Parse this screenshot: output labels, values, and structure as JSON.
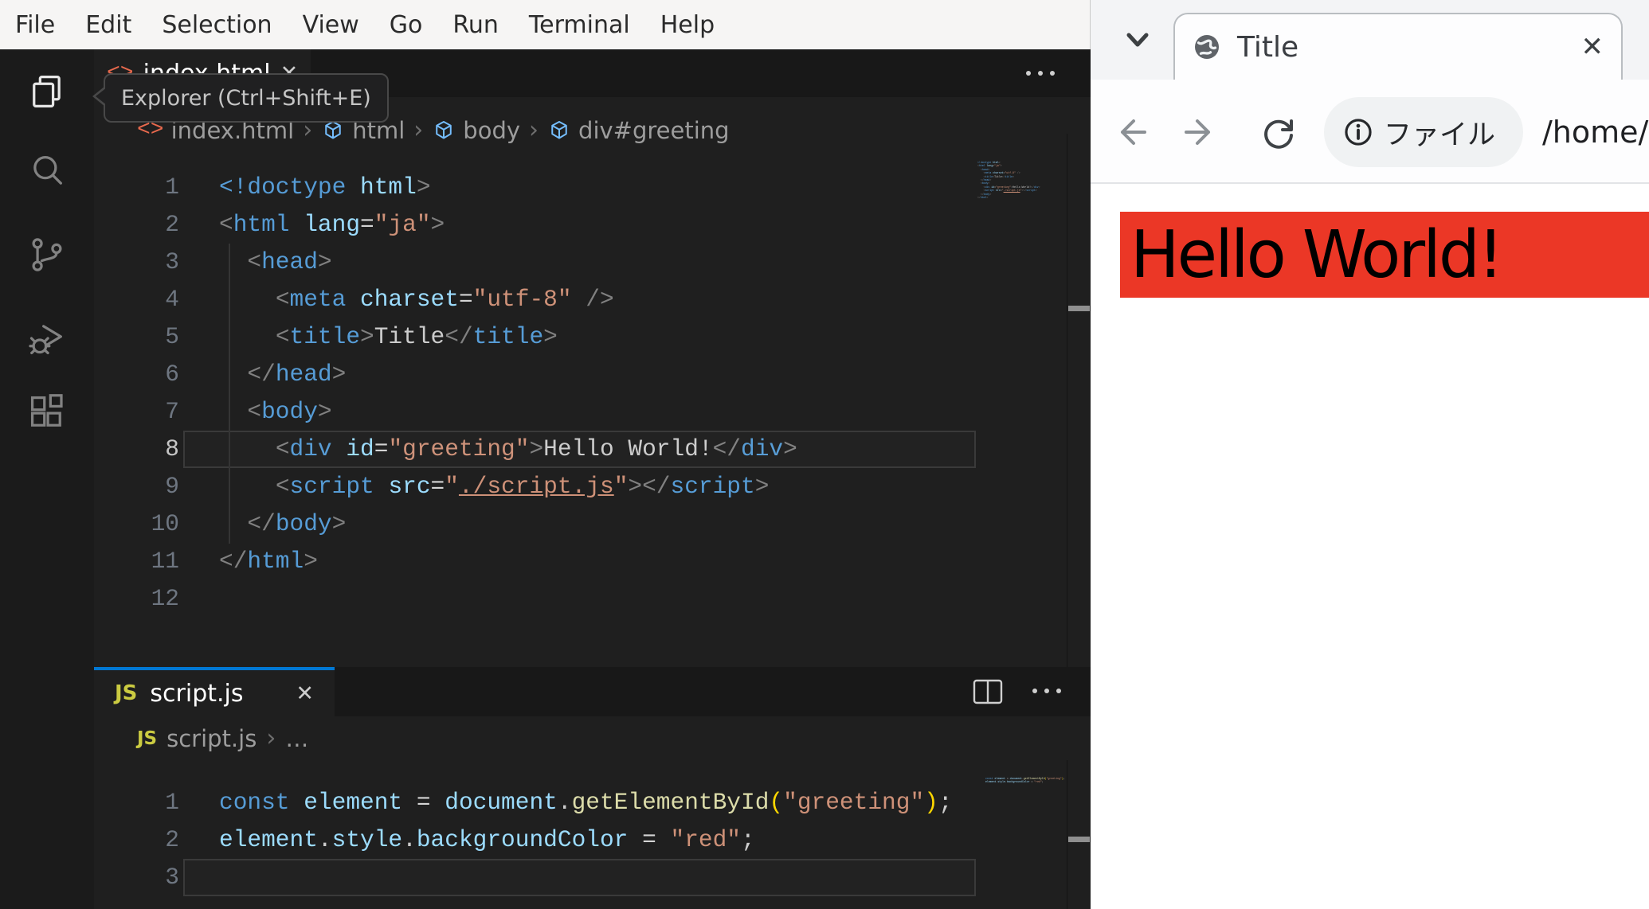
{
  "vscode": {
    "menu": [
      "File",
      "Edit",
      "Selection",
      "View",
      "Go",
      "Run",
      "Terminal",
      "Help"
    ],
    "activity_bar": [
      "explorer",
      "search",
      "source-control",
      "run-and-debug",
      "extensions"
    ],
    "tooltip": "Explorer (Ctrl+Shift+E)",
    "icons": {
      "close": "✕",
      "more_actions": "ellipsis",
      "split_editor": "split-editor-rect",
      "breadcrumb_separator": "›",
      "code_file": "<>",
      "js_file": "JS",
      "symbol_cube": "cube"
    },
    "top_editor": {
      "tab_label": "index.html",
      "breadcrumb": [
        {
          "icon": "code",
          "label": "index.html"
        },
        {
          "icon": "cube",
          "label": "html"
        },
        {
          "icon": "cube",
          "label": "body"
        },
        {
          "icon": "cube",
          "label": "div#greeting"
        }
      ],
      "active_line": 8,
      "lines": [
        [
          [
            "t",
            "<!doctype"
          ],
          [
            "x",
            " "
          ],
          [
            "a",
            "html"
          ],
          [
            "p",
            ">"
          ]
        ],
        [
          [
            "p",
            "<"
          ],
          [
            "t",
            "html"
          ],
          [
            "x",
            " "
          ],
          [
            "a",
            "lang"
          ],
          [
            "o",
            "="
          ],
          [
            "s",
            "\"ja\""
          ],
          [
            "p",
            ">"
          ]
        ],
        [
          [
            "x",
            "  "
          ],
          [
            "p",
            "<"
          ],
          [
            "t",
            "head"
          ],
          [
            "p",
            ">"
          ]
        ],
        [
          [
            "x",
            "    "
          ],
          [
            "p",
            "<"
          ],
          [
            "t",
            "meta"
          ],
          [
            "x",
            " "
          ],
          [
            "a",
            "charset"
          ],
          [
            "o",
            "="
          ],
          [
            "s",
            "\"utf-8\""
          ],
          [
            "x",
            " "
          ],
          [
            "p",
            "/>"
          ]
        ],
        [
          [
            "x",
            "    "
          ],
          [
            "p",
            "<"
          ],
          [
            "t",
            "title"
          ],
          [
            "p",
            ">"
          ],
          [
            "x",
            "Title"
          ],
          [
            "p",
            "</"
          ],
          [
            "t",
            "title"
          ],
          [
            "p",
            ">"
          ]
        ],
        [
          [
            "x",
            "  "
          ],
          [
            "p",
            "</"
          ],
          [
            "t",
            "head"
          ],
          [
            "p",
            ">"
          ]
        ],
        [
          [
            "x",
            "  "
          ],
          [
            "p",
            "<"
          ],
          [
            "t",
            "body"
          ],
          [
            "p",
            ">"
          ]
        ],
        [
          [
            "x",
            "    "
          ],
          [
            "p",
            "<"
          ],
          [
            "t",
            "div"
          ],
          [
            "x",
            " "
          ],
          [
            "a",
            "id"
          ],
          [
            "o",
            "="
          ],
          [
            "s",
            "\"greeting\""
          ],
          [
            "p",
            ">"
          ],
          [
            "x",
            "Hello World!"
          ],
          [
            "p",
            "</"
          ],
          [
            "t",
            "div"
          ],
          [
            "p",
            ">"
          ]
        ],
        [
          [
            "x",
            "    "
          ],
          [
            "p",
            "<"
          ],
          [
            "t",
            "script"
          ],
          [
            "x",
            " "
          ],
          [
            "a",
            "src"
          ],
          [
            "o",
            "="
          ],
          [
            "s",
            "\""
          ],
          [
            "u",
            "./script.js"
          ],
          [
            "s",
            "\""
          ],
          [
            "p",
            "></"
          ],
          [
            "t",
            "script"
          ],
          [
            "p",
            ">"
          ]
        ],
        [
          [
            "x",
            "  "
          ],
          [
            "p",
            "</"
          ],
          [
            "t",
            "body"
          ],
          [
            "p",
            ">"
          ]
        ],
        [
          [
            "p",
            "</"
          ],
          [
            "t",
            "html"
          ],
          [
            "p",
            ">"
          ]
        ],
        []
      ]
    },
    "bottom_editor": {
      "tab_label": "script.js",
      "breadcrumb_file": "script.js",
      "breadcrumb_more": "…",
      "active_line": 3,
      "lines": [
        [
          [
            "k",
            "const"
          ],
          [
            "x",
            " "
          ],
          [
            "v",
            "element"
          ],
          [
            "x",
            " "
          ],
          [
            "o",
            "="
          ],
          [
            "x",
            " "
          ],
          [
            "v",
            "document"
          ],
          [
            "x",
            "."
          ],
          [
            "f",
            "getElementById"
          ],
          [
            "b",
            "("
          ],
          [
            "s",
            "\"greeting\""
          ],
          [
            "b",
            ")"
          ],
          [
            "x",
            ";"
          ]
        ],
        [
          [
            "v",
            "element"
          ],
          [
            "x",
            "."
          ],
          [
            "v",
            "style"
          ],
          [
            "x",
            "."
          ],
          [
            "v",
            "backgroundColor"
          ],
          [
            "x",
            " "
          ],
          [
            "o",
            "="
          ],
          [
            "x",
            " "
          ],
          [
            "s",
            "\"red\""
          ],
          [
            "x",
            ";"
          ]
        ],
        []
      ]
    }
  },
  "browser": {
    "tab_title": "Title",
    "toolbar": {
      "chip_label": "ファイル",
      "url": "/home/u"
    },
    "page": {
      "text": "Hello World!",
      "background": "#eb3726"
    }
  },
  "colors": {
    "accent_blue": "#0078d4",
    "page_red": "#eb3726",
    "editor_bg": "#1f1f1f",
    "chrome_bg": "#181818",
    "menubar_bg": "#f6f5f4"
  }
}
